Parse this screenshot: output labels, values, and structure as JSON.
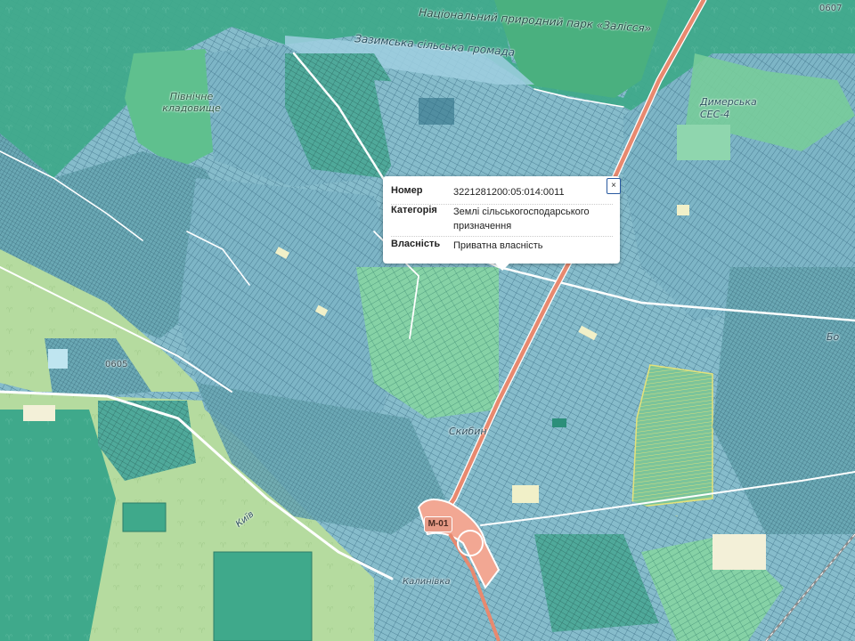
{
  "map": {
    "labels": {
      "park": "Національний природний парк «Залісся»",
      "community": "Зазимська сільська громада",
      "cemetery": "Північне кладовище",
      "ces": "Димерська СЕС-4",
      "town": "Скибин",
      "kyiv": "Київ",
      "road_code_1": "0605",
      "road_code_2": "0607",
      "town2": "Калинівка",
      "east": "Бо"
    },
    "road_shield": "М-01"
  },
  "popup": {
    "rows": [
      {
        "key": "Номер",
        "value": "3221281200:05:014:0011"
      },
      {
        "key": "Категорія",
        "value": "Землі сільськогосподарського призначення"
      },
      {
        "key": "Власність",
        "value": "Приватна власність"
      }
    ],
    "close_label": "×"
  },
  "colors": {
    "parcel_blue": "#7fb8c9",
    "parcel_teal": "#4aa597",
    "parcel_green": "#7fcf9e",
    "forest": "#3ea88a",
    "field": "#b7dc9f",
    "highway": "#e8896f",
    "road": "#ffffff"
  }
}
